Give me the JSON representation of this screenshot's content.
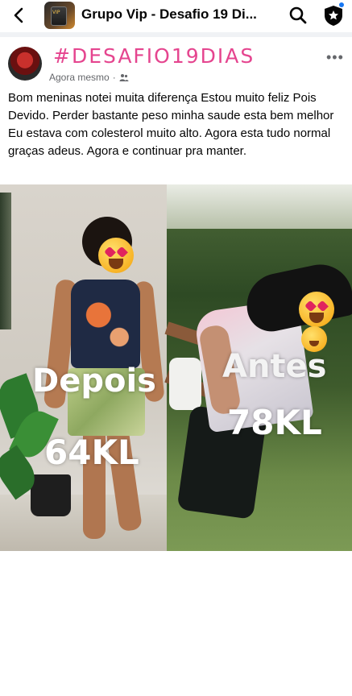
{
  "header": {
    "title": "Grupo Vip - Desafio 19 Di...",
    "back_icon": "chevron-left-icon",
    "search_icon": "search-icon",
    "shield_icon": "shield-star-icon",
    "accent_color": "#1877f2"
  },
  "post": {
    "hashtag": "#DESAFIO19DIAS",
    "hashtag_color": "#e5458f",
    "timestamp": "Agora mesmo",
    "privacy_icon": "group-icon",
    "more_icon": "more-dots-icon",
    "text": "Bom meninas notei muita diferença Estou muito feliz Pois  Devido. Perder bastante peso minha saude esta bem melhor Eu estava com colesterol muito alto. Agora esta tudo normal graças adeus. Agora e continuar pra manter."
  },
  "photo": {
    "after_label": "Depois",
    "after_weight": "64KL",
    "before_label": "Antes",
    "before_weight": "78KL"
  }
}
